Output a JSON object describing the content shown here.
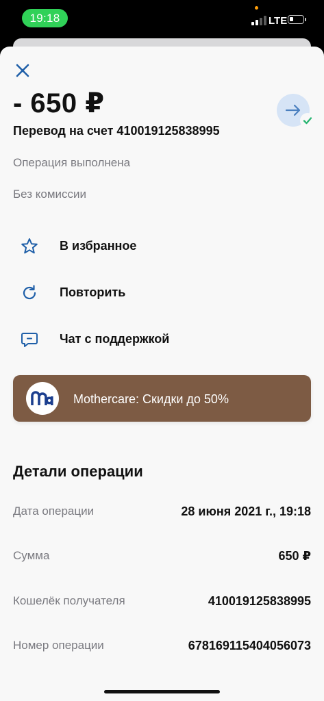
{
  "status_bar": {
    "time": "19:18",
    "network": "LTE"
  },
  "operation": {
    "amount": "- 650 ₽",
    "title": "Перевод на счет 410019125838995",
    "status": "Операция выполнена",
    "fee": "Без комиссии",
    "type_icon": "arrow-right-icon",
    "done_icon": "check-icon"
  },
  "actions": [
    {
      "label": "В избранное",
      "icon": "star-icon"
    },
    {
      "label": "Повторить",
      "icon": "refresh-icon"
    },
    {
      "label": "Чат с поддержкой",
      "icon": "chat-icon"
    }
  ],
  "promo": {
    "text": "Mothercare: Скидки до 50%",
    "logo_icon": "mothercare-logo"
  },
  "details": {
    "title": "Детали операции",
    "rows": [
      {
        "label": "Дата операции",
        "value": "28 июня 2021 г., 19:18"
      },
      {
        "label": "Сумма",
        "value": "650 ₽"
      },
      {
        "label": "Кошелёк получателя",
        "value": "410019125838995"
      },
      {
        "label": "Номер операции",
        "value": "678169115404056073"
      }
    ]
  },
  "colors": {
    "accent_blue": "#1f5fa8",
    "promo_bg": "#7d5b44",
    "status_green": "#30d158",
    "check_green": "#2bb673",
    "icon_circle_bg": "#d6e4f6"
  }
}
